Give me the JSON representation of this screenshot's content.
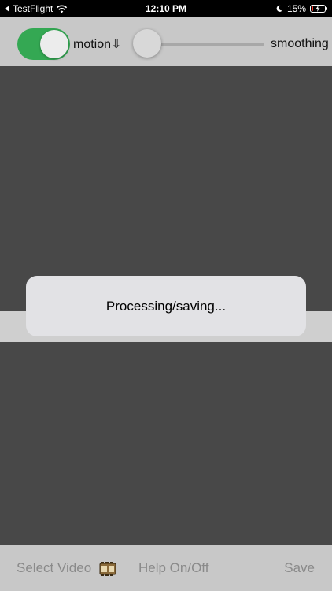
{
  "status_bar": {
    "back_app": "TestFlight",
    "time": "12:10 PM",
    "battery_percent": "15%",
    "battery_level": 0.15,
    "icons": [
      "back-arrow-icon",
      "wifi-icon",
      "moon-icon",
      "battery-icon",
      "charging-bolt-icon"
    ]
  },
  "top_toolbar": {
    "toggle_on": true,
    "motion_label": "motion⇩",
    "slider_value": 0.0,
    "smoothing_label": "smoothing"
  },
  "dialog": {
    "message": "Processing/saving..."
  },
  "bottom_toolbar": {
    "select_video_label": "Select Video",
    "help_label": "Help On/Off",
    "save_label": "Save"
  },
  "colors": {
    "toggle_on": "#34a853",
    "background": "#484848",
    "toolbar": "#c8c8c8",
    "battery_low": "#ff3b30",
    "disabled_text": "#8a8a8a"
  }
}
